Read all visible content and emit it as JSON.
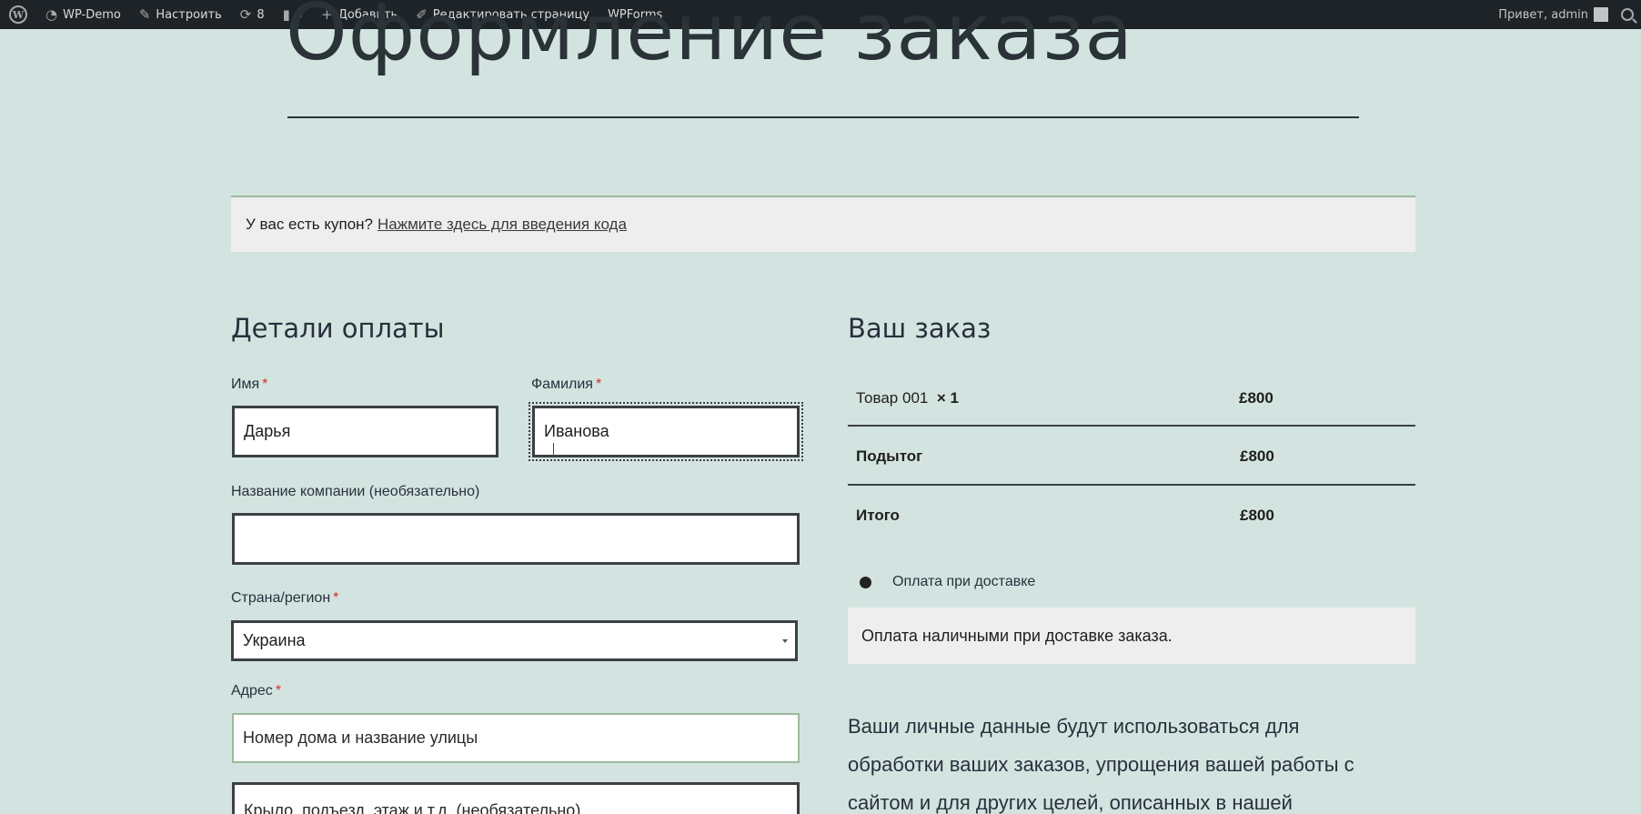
{
  "adminbar": {
    "site_name": "WP-Demo",
    "customize": "Настроить",
    "updates_count": "8",
    "comments_count": "0",
    "add_new": "Добавить",
    "edit_page": "Редактировать страницу",
    "wpforms": "WPForms",
    "greeting": "Привет, admin"
  },
  "page": {
    "title": "Оформление заказа"
  },
  "coupon": {
    "question": "У вас есть купон?",
    "link": "Нажмите здесь для введения кода"
  },
  "billing": {
    "heading": "Детали оплаты",
    "first_name": {
      "label": "Имя",
      "required": "*",
      "value": "Дарья"
    },
    "last_name": {
      "label": "Фамилия",
      "required": "*",
      "value": "Иванова"
    },
    "company": {
      "label": "Название компании (необязательно)",
      "value": ""
    },
    "country": {
      "label": "Страна/регион",
      "required": "*",
      "value": "Украина"
    },
    "address": {
      "label": "Адрес",
      "required": "*",
      "line1_placeholder": "Номер дома и название улицы",
      "line2_placeholder": "Крыло, подъезд, этаж и т.д. (необязательно)"
    }
  },
  "order": {
    "heading": "Ваш заказ",
    "item_name": "Товар 001",
    "item_qty": "× 1",
    "item_price": "£800",
    "subtotal_label": "Подытог",
    "subtotal_value": "£800",
    "total_label": "Итого",
    "total_value": "£800",
    "payment_method": "Оплата при доставке",
    "payment_description": "Оплата наличными при доставке заказа.",
    "privacy_text": "Ваши личные данные будут использоваться для обработки ваших заказов, упрощения вашей работы с сайтом и для других целей, описанных в нашей"
  },
  "colors": {
    "background": "#d3e4e0",
    "adminbar": "#1d2327",
    "required": "#d1302a",
    "panel": "#eeeeee"
  }
}
